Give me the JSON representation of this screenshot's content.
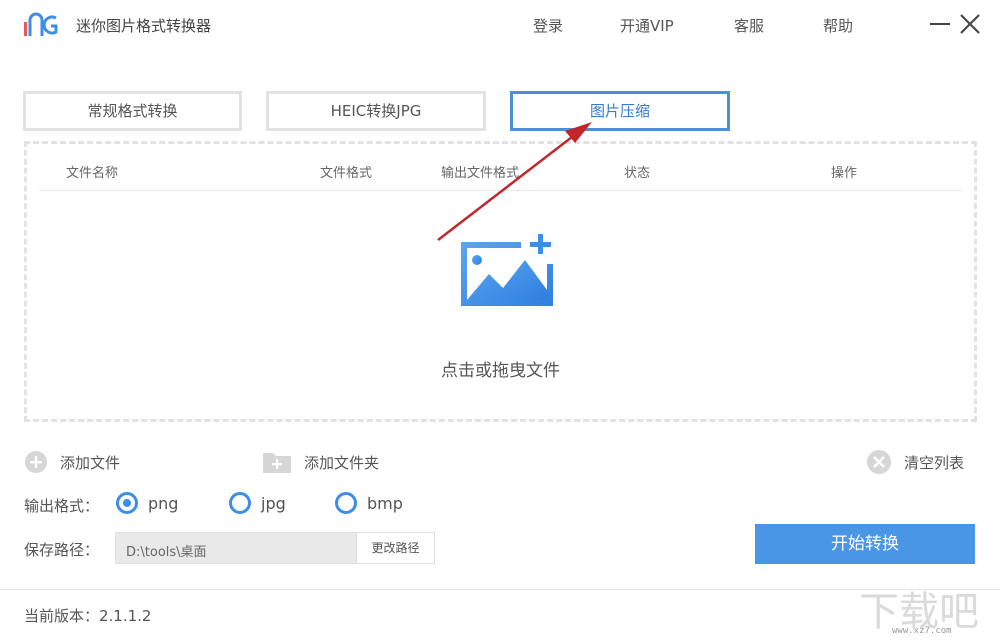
{
  "app": {
    "title": "迷你图片格式转换器"
  },
  "topnav": {
    "login": "登录",
    "vip": "开通VIP",
    "service": "客服",
    "help": "帮助"
  },
  "tabs": [
    {
      "label": "常规格式转换",
      "active": false
    },
    {
      "label": "HEIC转换JPG",
      "active": false
    },
    {
      "label": "图片压缩",
      "active": true
    }
  ],
  "table": {
    "headers": [
      "文件名称",
      "文件格式",
      "输出文件格式",
      "状态",
      "操作"
    ]
  },
  "dropzone": {
    "hint": "点击或拖曳文件",
    "icon": "add-image-icon"
  },
  "actions": {
    "add_file": "添加文件",
    "add_folder": "添加文件夹",
    "clear_list": "清空列表"
  },
  "output_format": {
    "label": "输出格式：",
    "options": [
      "png",
      "jpg",
      "bmp"
    ],
    "selected": "png"
  },
  "save_path": {
    "label": "保存路径：",
    "value": "D:\\tools\\桌面",
    "change_button": "更改路径"
  },
  "start_button": "开始转换",
  "footer": {
    "version": "当前版本：2.1.1.2"
  },
  "watermark": {
    "text": "www.xz7.com"
  },
  "colors": {
    "accent": "#4a96e6",
    "active_tab_border": "#4a90d9",
    "arrow": "#c0272d"
  }
}
